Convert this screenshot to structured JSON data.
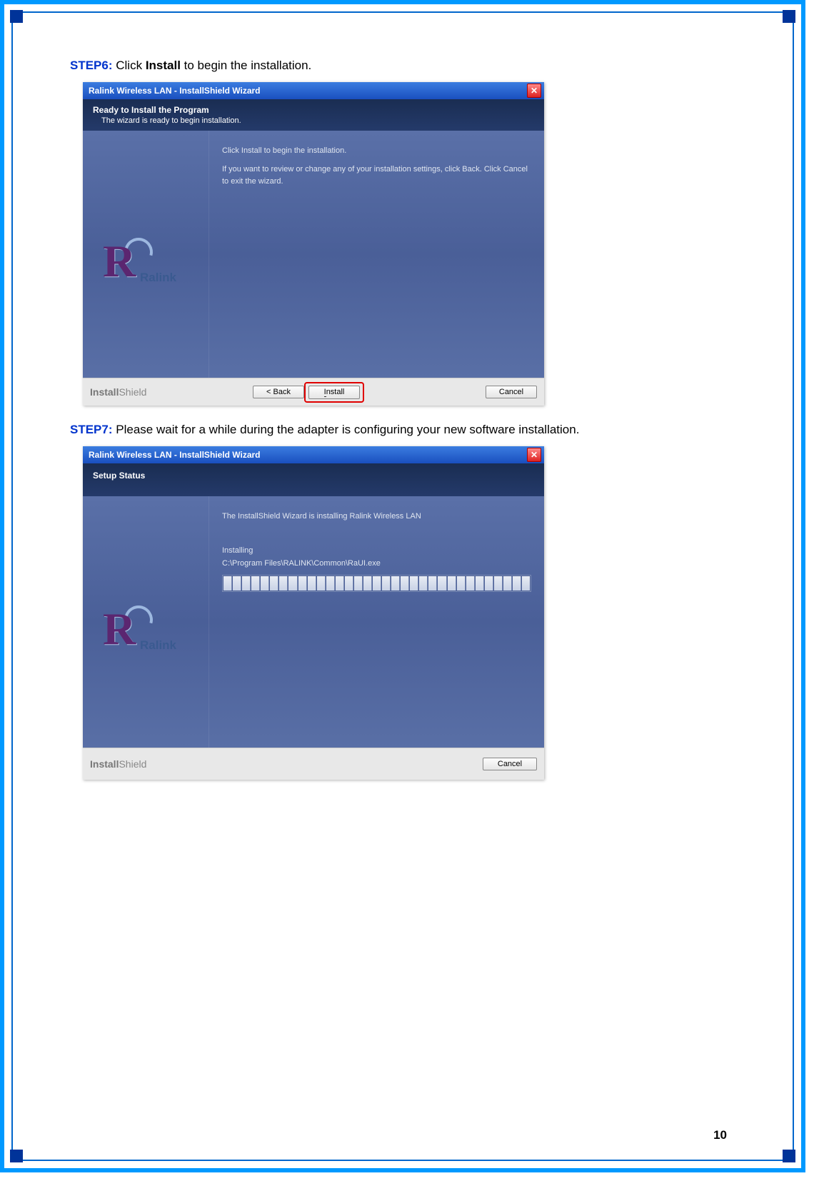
{
  "step6": {
    "label": "STEP6:",
    "text_a": " Click ",
    "bold": "Install",
    "text_b": " to begin the installation."
  },
  "step7": {
    "label": "STEP7:",
    "text": " Please wait for a while during the adapter is configuring your new software installation."
  },
  "wizard1": {
    "title": "Ralink Wireless LAN - InstallShield Wizard",
    "header_title": "Ready to Install the Program",
    "header_sub": "The wizard is ready to begin installation.",
    "body_line1": "Click Install to begin the installation.",
    "body_line2": "If you want to review or change any of your installation settings, click Back. Click Cancel to exit the wizard.",
    "logo_brand": "Ralink",
    "footer_brand_bold": "Install",
    "footer_brand_light": "Shield",
    "btn_back": "< Back",
    "btn_install": "Install",
    "btn_cancel": "Cancel"
  },
  "wizard2": {
    "title": "Ralink Wireless LAN - InstallShield Wizard",
    "header_title": "Setup Status",
    "body_line1": "The InstallShield Wizard is installing Ralink Wireless LAN",
    "installing": "Installing",
    "path": "C:\\Program Files\\RALINK\\Common\\RaUI.exe",
    "logo_brand": "Ralink",
    "footer_brand_bold": "Install",
    "footer_brand_light": "Shield",
    "btn_cancel": "Cancel"
  },
  "page_number": "10"
}
